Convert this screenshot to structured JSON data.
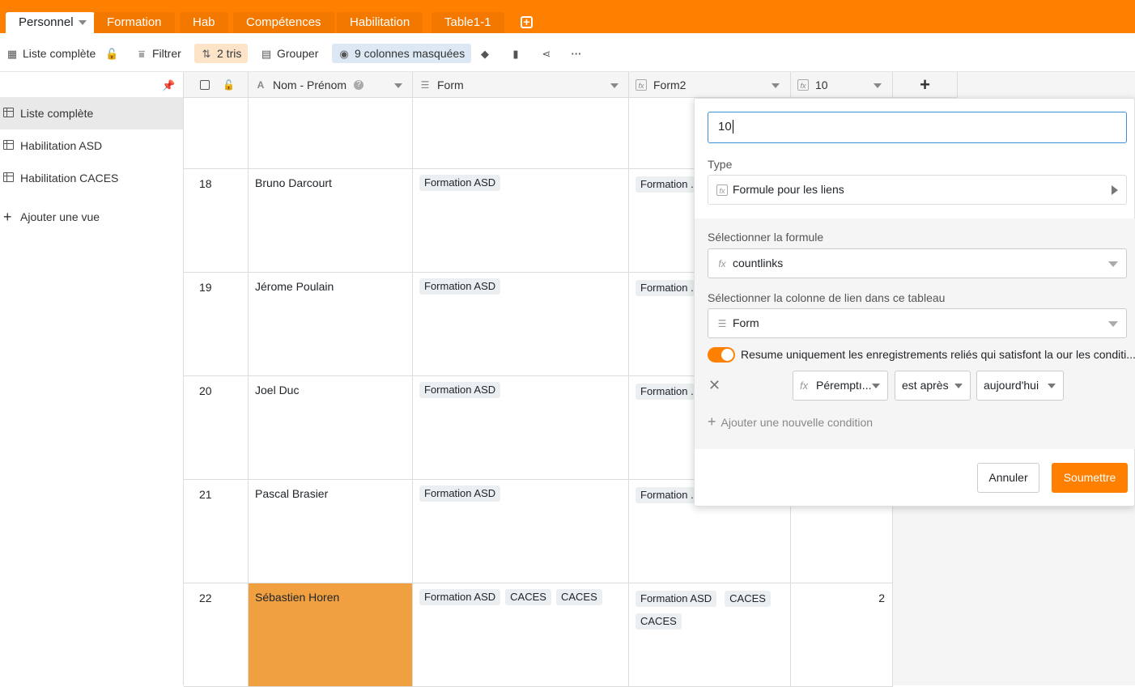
{
  "tabs": [
    {
      "label": "Personnel",
      "active": true
    },
    {
      "label": "Formation"
    },
    {
      "label": "Hab"
    },
    {
      "label": "Compétences"
    },
    {
      "label": "Habilitation"
    },
    {
      "label": "Table1-1"
    }
  ],
  "toolbar": {
    "view": "Liste complète",
    "filter": "Filtrer",
    "sort": "2 tris",
    "group": "Grouper",
    "hidden": "9 colonnes masquées"
  },
  "sidebar": {
    "views": [
      {
        "label": "Liste complète",
        "active": true
      },
      {
        "label": "Habilitation ASD"
      },
      {
        "label": "Habilitation CACES"
      }
    ],
    "add_view": "Ajouter une vue"
  },
  "columns": {
    "name": "Nom - Prénom",
    "form": "Form",
    "form2": "Form2",
    "ten": "10"
  },
  "rows": [
    {
      "num": "",
      "name": "",
      "form": [],
      "form2": [],
      "ten": ""
    },
    {
      "num": "18",
      "name": "Bruno Darcourt",
      "form": [
        "Formation ASD"
      ],
      "form2": [
        "Formation ..."
      ],
      "ten": ""
    },
    {
      "num": "19",
      "name": "Jérome Poulain",
      "form": [
        "Formation ASD"
      ],
      "form2": [
        "Formation ..."
      ],
      "ten": ""
    },
    {
      "num": "20",
      "name": "Joel Duc",
      "form": [
        "Formation ASD"
      ],
      "form2": [
        "Formation ..."
      ],
      "ten": ""
    },
    {
      "num": "21",
      "name": "Pascal Brasier",
      "form": [
        "Formation ASD"
      ],
      "form2": [
        "Formation ..."
      ],
      "ten": ""
    },
    {
      "num": "22",
      "name": "Sébastien Horen",
      "form": [
        "Formation ASD",
        "CACES",
        "CACES"
      ],
      "form2": [
        "Formation ASD",
        "CACES",
        "CACES"
      ],
      "ten": "2",
      "highlight": true
    }
  ],
  "popup": {
    "column_name": "10",
    "type_label": "Type",
    "type_value": "Formule pour les liens",
    "formula_label": "Sélectionner la formule",
    "formula_value": "countlinks",
    "link_label": "Sélectionner la colonne de lien dans ce tableau",
    "link_value": "Form",
    "toggle_text": "Resume uniquement les enregistrements reliés qui satisfont la our les conditi...",
    "toggle_on": true,
    "condition": {
      "field": "Péremptı...",
      "operator": "est après",
      "value": "aujourd'hui"
    },
    "add_condition": "Ajouter une nouvelle condition",
    "cancel": "Annuler",
    "submit": "Soumettre"
  },
  "colors": {
    "accent": "#ff8000",
    "tab_inactive": "#f27800",
    "highlight_cell": "#f0a040",
    "sort_bg": "#fde4c8",
    "hidden_bg": "#dde8f5"
  }
}
